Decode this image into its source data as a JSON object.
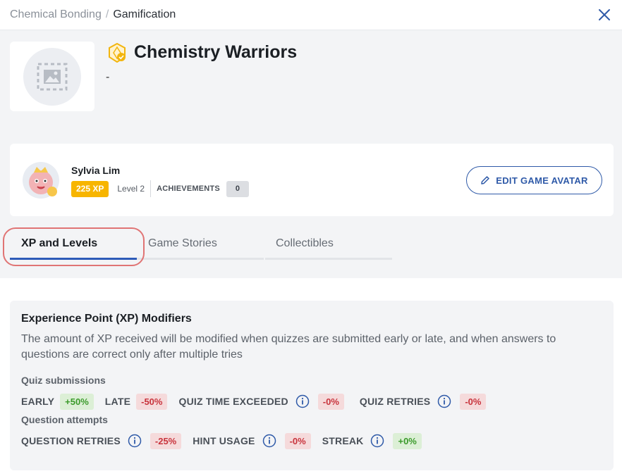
{
  "breadcrumb": {
    "parent": "Chemical Bonding",
    "separator": "/",
    "current": "Gamification"
  },
  "game": {
    "title": "Chemistry Warriors",
    "description": "-"
  },
  "player": {
    "name": "Sylvia Lim",
    "xp": "225 XP",
    "level": "Level 2",
    "achievements_label": "ACHIEVEMENTS",
    "achievements_count": "0",
    "edit_button": "EDIT GAME AVATAR"
  },
  "tabs": [
    {
      "label": "XP and Levels",
      "active": true
    },
    {
      "label": "Game Stories",
      "active": false
    },
    {
      "label": "Collectibles",
      "active": false
    }
  ],
  "xp_modifiers": {
    "title": "Experience Point (XP) Modifiers",
    "description": "The amount of XP received will be modified when quizzes are submitted early or late, and when answers to questions are correct only after multiple tries",
    "quiz_heading": "Quiz submissions",
    "quiz": [
      {
        "label": "EARLY",
        "value": "+50%",
        "info": false,
        "tone": "pos"
      },
      {
        "label": "LATE",
        "value": "-50%",
        "info": false,
        "tone": "neg"
      },
      {
        "label": "QUIZ TIME EXCEEDED",
        "value": "-0%",
        "info": true,
        "tone": "neg"
      },
      {
        "label": "QUIZ RETRIES",
        "value": "-0%",
        "info": true,
        "tone": "neg"
      }
    ],
    "question_heading": "Question attempts",
    "question": [
      {
        "label": "QUESTION RETRIES",
        "value": "-25%",
        "info": true,
        "tone": "neg"
      },
      {
        "label": "HINT USAGE",
        "value": "-0%",
        "info": true,
        "tone": "neg"
      },
      {
        "label": "STREAK",
        "value": "+0%",
        "info": true,
        "tone": "pos"
      }
    ]
  },
  "colors": {
    "accent": "#2d5bb8",
    "xp_badge": "#f7b500",
    "positive": "#3a9a2a",
    "negative": "#c8333c",
    "highlight": "#e07474"
  },
  "icons": {
    "close": "close-icon",
    "title_badge": "achievement-badge-icon",
    "edit": "pencil-icon",
    "info": "info-icon",
    "placeholder": "image-placeholder-icon"
  }
}
